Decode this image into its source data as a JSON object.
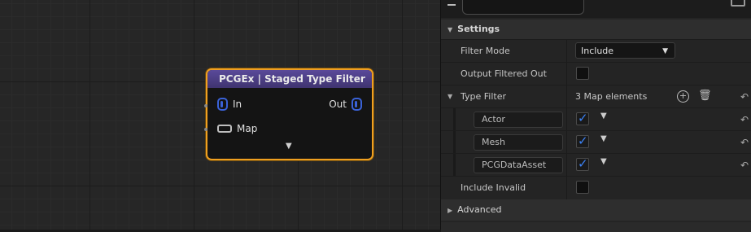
{
  "node": {
    "title": "PCGEx | Staged Type Filter",
    "pins": {
      "in": "In",
      "map": "Map",
      "out": "Out"
    }
  },
  "panel": {
    "settings_section": "Settings",
    "filter_mode": {
      "label": "Filter Mode",
      "value": "Include"
    },
    "output_filtered_out": {
      "label": "Output Filtered Out",
      "checked": false
    },
    "type_filter": {
      "label": "Type Filter",
      "summary": "3 Map elements"
    },
    "elements": [
      {
        "name": "Actor",
        "checked": true
      },
      {
        "name": "Mesh",
        "checked": true
      },
      {
        "name": "PCGDataAsset",
        "checked": true
      }
    ],
    "include_invalid": {
      "label": "Include Invalid",
      "checked": false
    },
    "advanced_section": "Advanced"
  },
  "colors": {
    "node_border": "#f0a020",
    "node_header": "#4b3f82",
    "pin_blue": "#3a62d8",
    "check_blue": "#3b82f6"
  },
  "icons": {
    "revert": "revert-icon",
    "add": "add-circle-icon",
    "trash": "trash-icon"
  }
}
